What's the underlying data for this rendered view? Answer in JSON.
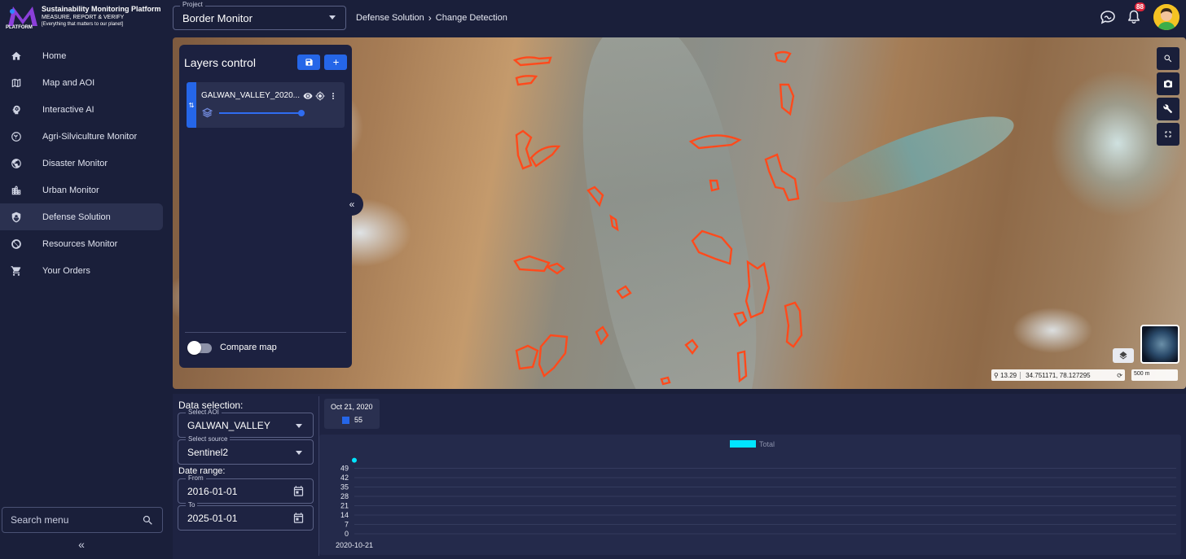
{
  "brand": {
    "logo_text": "PLATFORM",
    "title": "Sustainability Monitoring Platform",
    "subtitle": "MEASURE, REPORT & VERIFY",
    "tagline": "[Everything that matters to our planet]"
  },
  "sidebar": {
    "items": [
      {
        "label": "Home",
        "icon": "home-icon",
        "active": false
      },
      {
        "label": "Map and AOI",
        "icon": "map-icon",
        "active": false
      },
      {
        "label": "Interactive AI",
        "icon": "ai-brain-icon",
        "active": false
      },
      {
        "label": "Agri-Silviculture Monitor",
        "icon": "plant-icon",
        "active": false
      },
      {
        "label": "Disaster Monitor",
        "icon": "globe-icon",
        "active": false
      },
      {
        "label": "Urban Monitor",
        "icon": "city-icon",
        "active": false
      },
      {
        "label": "Defense Solution",
        "icon": "shield-icon",
        "active": true
      },
      {
        "label": "Resources Monitor",
        "icon": "resources-icon",
        "active": false
      },
      {
        "label": "Your Orders",
        "icon": "cart-icon",
        "active": false
      }
    ],
    "search_label": "Search menu"
  },
  "header": {
    "project_legend": "Project",
    "project_value": "Border Monitor",
    "breadcrumb": [
      "Defense Solution",
      "Change Detection"
    ],
    "notification_count": "88"
  },
  "layers": {
    "title": "Layers control",
    "layer_name": "GALWAN_VALLEY_2020...",
    "opacity": 1.0,
    "compare_label": "Compare map",
    "compare_on": false
  },
  "map": {
    "zoom": "13.29",
    "coords": "34.751171, 78.127295",
    "scale": "500 m"
  },
  "data_selection": {
    "heading": "Data selection:",
    "aoi_legend": "Select AOI",
    "aoi_value": "GALWAN_VALLEY",
    "source_legend": "Select source",
    "source_value": "Sentinel2",
    "date_range_heading": "Date range:",
    "from_legend": "From",
    "from_value": "2016-01-01",
    "to_legend": "To",
    "to_value": "2025-01-01"
  },
  "date_card": {
    "date": "Oct 21, 2020",
    "value": "55"
  },
  "colors": {
    "accent": "#2566e8",
    "series": "#00e5ff",
    "change_polygons": "#ff4a1c"
  },
  "chart_data": {
    "type": "scatter",
    "categories": [
      "2020-10-21"
    ],
    "series": [
      {
        "name": "Total",
        "values": [
          55
        ]
      }
    ],
    "yticks": [
      0,
      7,
      14,
      21,
      28,
      35,
      42,
      49
    ],
    "ylim": [
      0,
      56
    ],
    "legend": "top-center",
    "grid": true
  }
}
